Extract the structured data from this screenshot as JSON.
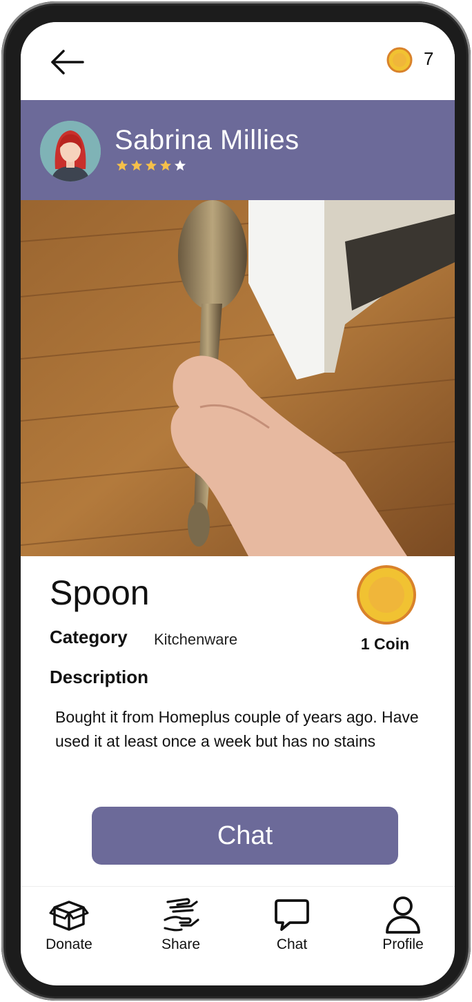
{
  "header": {
    "coin_count": "7"
  },
  "user": {
    "name": "Sabrina Millies",
    "rating": 4,
    "rating_max": 5
  },
  "item": {
    "title": "Spoon",
    "category_label": "Category",
    "category_value": "Kitchenware",
    "price_label": "1 Coin",
    "description_label": "Description",
    "description": "Bought it from Homeplus couple of years ago. Have used it at least once a week but has no stains"
  },
  "actions": {
    "chat_label": "Chat"
  },
  "nav": {
    "items": [
      {
        "label": "Donate",
        "icon": "box-icon"
      },
      {
        "label": "Share",
        "icon": "hand-share-icon"
      },
      {
        "label": "Chat",
        "icon": "chat-bubble-icon"
      },
      {
        "label": "Profile",
        "icon": "person-icon"
      }
    ]
  },
  "colors": {
    "accent": "#6c6a99",
    "coin": "#f1c232",
    "coin_ring": "#d9822b"
  }
}
